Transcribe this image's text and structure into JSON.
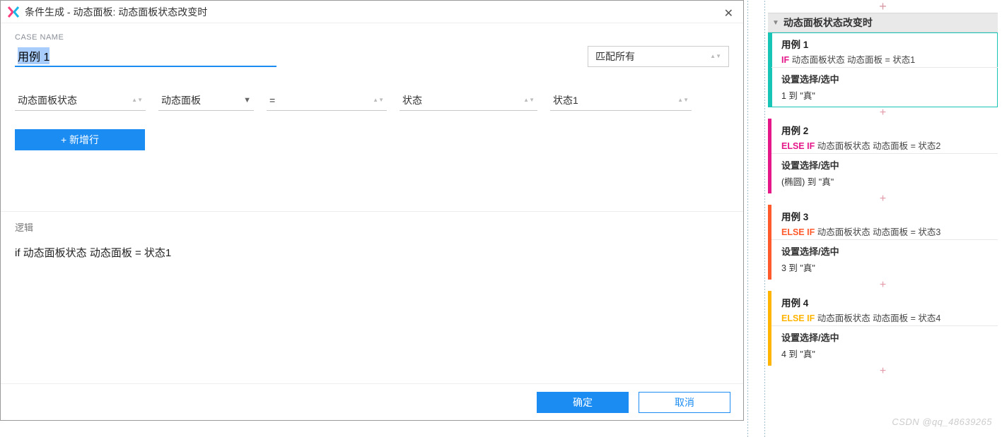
{
  "title": {
    "app": "条件生成",
    "sep": "  -  ",
    "context": "动态面板: 动态面板状态改变时"
  },
  "caseNameLabel": "CASE NAME",
  "caseName": "用例 1",
  "matchSelect": "匹配所有",
  "condition": {
    "field1": "动态面板状态",
    "field2": "动态面板",
    "field3": "=",
    "field4": "状态",
    "field5": "状态1"
  },
  "addRow": "+ 新增行",
  "logicLabel": "逻辑",
  "logicText": "if 动态面板状态 动态面板 = 状态1",
  "ok": "确定",
  "cancel": "取消",
  "eventHeader": "动态面板状态改变时",
  "cases": [
    {
      "name": "用例 1",
      "kw": "IF",
      "cond": "动态面板状态 动态面板 = 状态1",
      "action": "设置选择/选中",
      "detail": "1 到 \"真\"",
      "color": "c1",
      "selected": true
    },
    {
      "name": "用例 2",
      "kw": "ELSE IF",
      "cond": "动态面板状态 动态面板 = 状态2",
      "action": "设置选择/选中",
      "detail": "(椭圆) 到 \"真\"",
      "color": "c2",
      "selected": false
    },
    {
      "name": "用例 3",
      "kw": "ELSE IF",
      "cond": "动态面板状态 动态面板 = 状态3",
      "action": "设置选择/选中",
      "detail": "3 到 \"真\"",
      "color": "c3",
      "selected": false
    },
    {
      "name": "用例 4",
      "kw": "ELSE IF",
      "cond": "动态面板状态 动态面板 = 状态4",
      "action": "设置选择/选中",
      "detail": "4 到 \"真\"",
      "color": "c4",
      "selected": false
    }
  ],
  "watermark": "CSDN @qq_48639265"
}
